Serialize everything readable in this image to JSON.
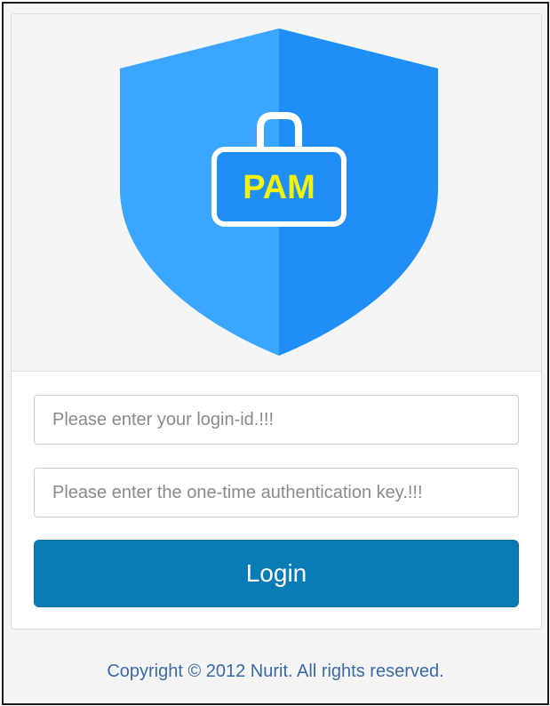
{
  "logo": {
    "icon": "shield-lock-icon",
    "text": "PAM",
    "colors": {
      "shield_left": "#3aa6ff",
      "shield_right": "#1f8ff7",
      "lock": "#ffffff",
      "text": "#f2f20a"
    }
  },
  "form": {
    "login_id_placeholder": "Please enter your login-id.!!!",
    "otp_placeholder": "Please enter the one-time authentication key.!!!",
    "login_button": "Login"
  },
  "footer": {
    "copyright": "Copyright © 2012 Nurit. All rights reserved."
  },
  "colors": {
    "button": "#0a7cb5",
    "footer_text": "#3a6aa5"
  }
}
